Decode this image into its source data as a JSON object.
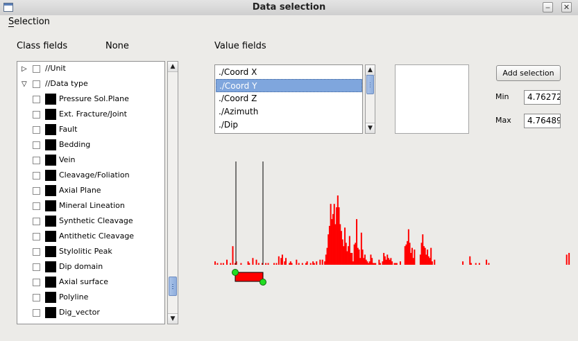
{
  "window": {
    "title": "Data selection"
  },
  "menu": {
    "selection": "Selection"
  },
  "class_fields": {
    "label": "Class fields",
    "value": "None",
    "items": [
      {
        "kind": "group",
        "expander": "collapsed",
        "label": "//Unit"
      },
      {
        "kind": "group",
        "expander": "expanded",
        "label": "//Data type"
      },
      {
        "kind": "item",
        "label": "Pressure Sol.Plane",
        "swatch": "#000000"
      },
      {
        "kind": "item",
        "label": "Ext. Fracture/Joint",
        "swatch": "#000000"
      },
      {
        "kind": "item",
        "label": "Fault",
        "swatch": "#000000"
      },
      {
        "kind": "item",
        "label": "Bedding",
        "swatch": "#000000"
      },
      {
        "kind": "item",
        "label": "Vein",
        "swatch": "#000000"
      },
      {
        "kind": "item",
        "label": "Cleavage/Foliation",
        "swatch": "#000000"
      },
      {
        "kind": "item",
        "label": "Axial Plane",
        "swatch": "#000000"
      },
      {
        "kind": "item",
        "label": "Mineral Lineation",
        "swatch": "#000000"
      },
      {
        "kind": "item",
        "label": "Synthetic Cleavage",
        "swatch": "#000000"
      },
      {
        "kind": "item",
        "label": "Antithetic Cleavage",
        "swatch": "#000000"
      },
      {
        "kind": "item",
        "label": "Stylolitic Peak",
        "swatch": "#000000"
      },
      {
        "kind": "item",
        "label": "Dip domain",
        "swatch": "#000000"
      },
      {
        "kind": "item",
        "label": "Axial surface",
        "swatch": "#000000"
      },
      {
        "kind": "item",
        "label": "Polyline",
        "swatch": "#000000"
      },
      {
        "kind": "item",
        "label": "Dig_vector",
        "swatch": "#000000"
      }
    ],
    "scroll_fraction": 0.92
  },
  "value_fields": {
    "label": "Value fields",
    "items": [
      "./Coord X",
      "./Coord Y",
      "./Coord Z",
      "./Azimuth",
      "./Dip"
    ],
    "selected_index": 1
  },
  "add_selection": {
    "label": "Add selection"
  },
  "min": {
    "label": "Min",
    "value": "4.76272"
  },
  "max": {
    "label": "Max",
    "value": "4.76489"
  },
  "histogram": {
    "bar_color": "#ff0000",
    "bins": [
      2,
      0,
      1,
      0,
      0,
      1,
      0,
      1,
      0,
      0,
      3,
      0,
      0,
      1,
      0,
      11,
      0,
      1,
      2,
      0,
      0,
      0,
      1,
      0,
      0,
      0,
      0,
      0,
      2,
      1,
      0,
      0,
      4,
      0,
      0,
      3,
      0,
      1,
      0,
      0,
      1,
      0,
      0,
      1,
      0,
      1,
      0,
      0,
      0,
      0,
      1,
      0,
      1,
      0,
      5,
      0,
      4,
      6,
      0,
      2,
      4,
      0,
      0,
      1,
      2,
      1,
      0,
      0,
      0,
      3,
      0,
      1,
      0,
      0,
      1,
      0,
      0,
      1,
      2,
      0,
      0,
      1,
      0,
      2,
      1,
      0,
      2,
      0,
      0,
      3,
      0,
      3,
      0,
      2,
      6,
      10,
      18,
      23,
      36,
      27,
      30,
      36,
      24,
      34,
      41,
      34,
      24,
      20,
      15,
      11,
      22,
      13,
      8,
      11,
      17,
      7,
      7,
      2,
      12,
      13,
      27,
      10,
      9,
      4,
      19,
      9,
      4,
      6,
      3,
      2,
      1,
      2,
      6,
      4,
      1,
      1,
      1,
      0,
      0,
      3,
      1,
      0,
      2,
      7,
      5,
      3,
      6,
      4,
      3,
      4,
      2,
      0,
      1,
      1,
      1,
      0,
      0,
      2,
      0,
      0,
      0,
      11,
      12,
      14,
      21,
      13,
      7,
      10,
      4,
      9,
      0,
      0,
      0,
      0,
      6,
      13,
      18,
      11,
      10,
      6,
      9,
      5,
      4,
      10,
      2,
      0,
      3,
      0,
      0,
      0,
      0,
      0,
      0,
      0,
      0,
      0,
      0,
      0,
      0,
      0,
      0,
      0,
      0,
      0,
      0,
      0,
      0,
      0,
      0,
      0,
      2,
      0,
      0,
      0,
      0,
      0,
      5,
      1,
      0,
      0,
      0,
      1,
      0,
      0,
      1,
      0,
      0,
      0,
      0,
      0,
      3,
      0,
      1,
      0,
      0,
      0,
      0,
      0,
      0,
      0,
      0,
      0,
      0,
      0,
      0,
      0,
      0,
      0,
      0,
      0,
      0,
      0,
      0,
      0,
      0,
      0,
      0,
      0,
      0,
      0,
      0,
      0,
      0,
      0,
      0,
      0,
      0,
      0,
      0,
      0,
      0,
      0,
      0,
      0,
      0,
      0,
      0,
      0,
      0,
      0,
      0,
      0,
      0,
      0,
      0,
      0,
      0,
      0,
      0,
      0,
      0,
      0,
      0,
      0,
      0,
      0,
      0,
      0,
      6,
      0,
      7,
      0,
      0,
      0,
      0,
      0,
      0
    ]
  }
}
